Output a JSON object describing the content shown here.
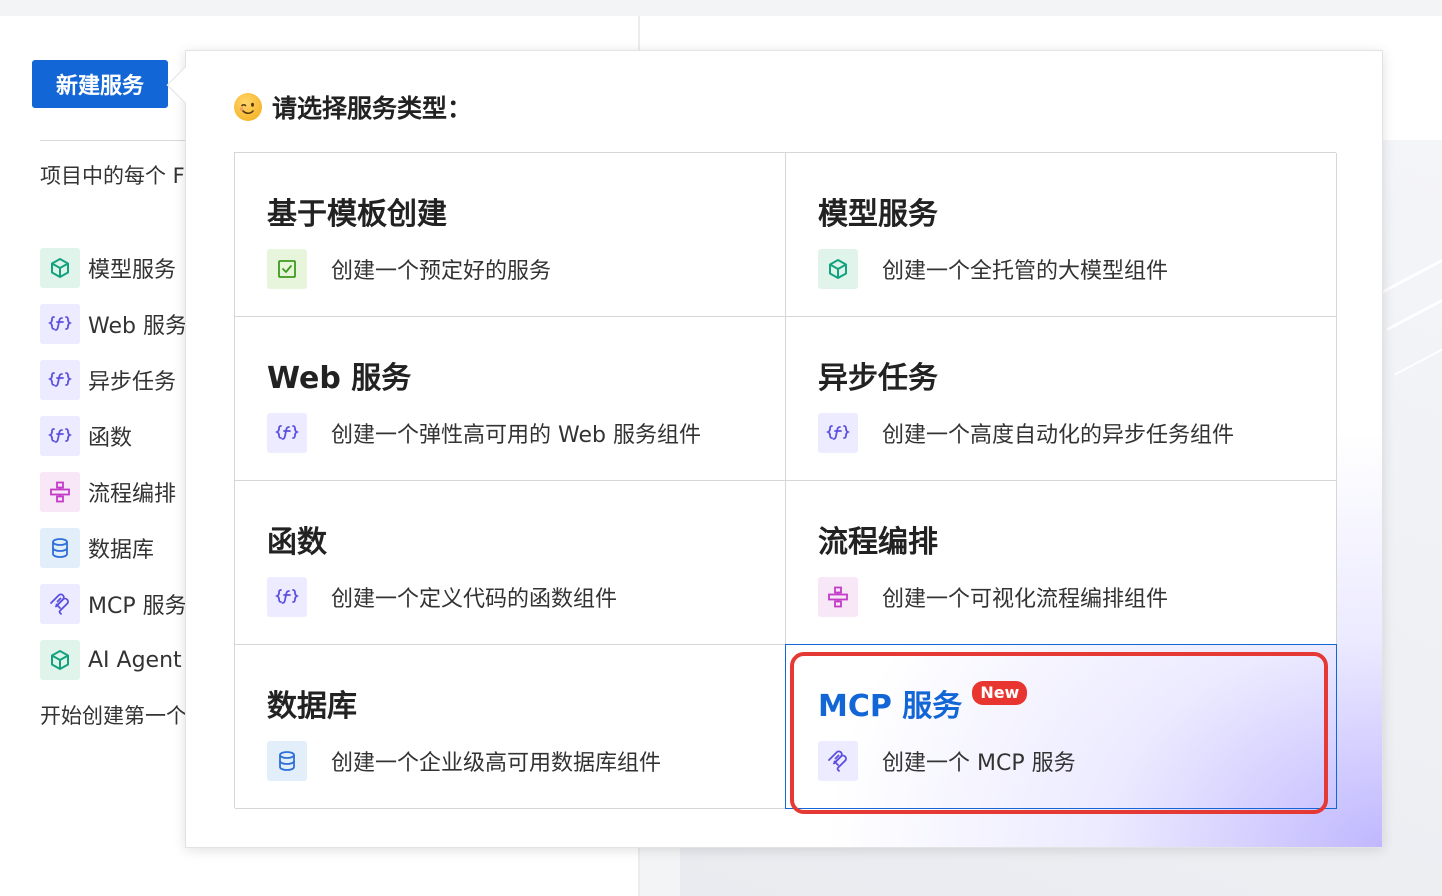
{
  "background": {
    "new_service_button": "新建服务",
    "description": "项目中的每个 Function AI 创",
    "items": [
      {
        "label": "模型服务",
        "icon": "cube-icon"
      },
      {
        "label": "Web 服务",
        "icon": "function-icon"
      },
      {
        "label": "异步任务",
        "icon": "function-icon"
      },
      {
        "label": "函数",
        "icon": "function-icon"
      },
      {
        "label": "流程编排",
        "icon": "workflow-icon"
      },
      {
        "label": "数据库",
        "icon": "database-icon"
      },
      {
        "label": "MCP 服务",
        "icon": "mcp-icon"
      },
      {
        "label": "AI Agent",
        "icon": "cube-icon"
      }
    ],
    "footer": "开始创建第一个"
  },
  "popover": {
    "title": "请选择服务类型：",
    "title_icon": "winking-face-emoji-icon",
    "cards": [
      {
        "title": "基于模板创建",
        "desc": "创建一个预定好的服务",
        "icon": "checkbox-icon"
      },
      {
        "title": "模型服务",
        "desc": "创建一个全托管的大模型组件",
        "icon": "cube-icon"
      },
      {
        "title": "Web 服务",
        "desc": "创建一个弹性高可用的 Web 服务组件",
        "icon": "function-icon"
      },
      {
        "title": "异步任务",
        "desc": "创建一个高度自动化的异步任务组件",
        "icon": "function-icon"
      },
      {
        "title": "函数",
        "desc": "创建一个定义代码的函数组件",
        "icon": "function-icon"
      },
      {
        "title": "流程编排",
        "desc": "创建一个可视化流程编排组件",
        "icon": "workflow-icon"
      },
      {
        "title": "数据库",
        "desc": "创建一个企业级高可用数据库组件",
        "icon": "database-icon"
      },
      {
        "title": "MCP 服务",
        "desc": "创建一个 MCP 服务",
        "icon": "mcp-icon",
        "badge": "New",
        "selected": true
      }
    ]
  },
  "colors": {
    "primary": "#1366d6",
    "badge": "#e8352f",
    "highlight": "#e53935"
  }
}
